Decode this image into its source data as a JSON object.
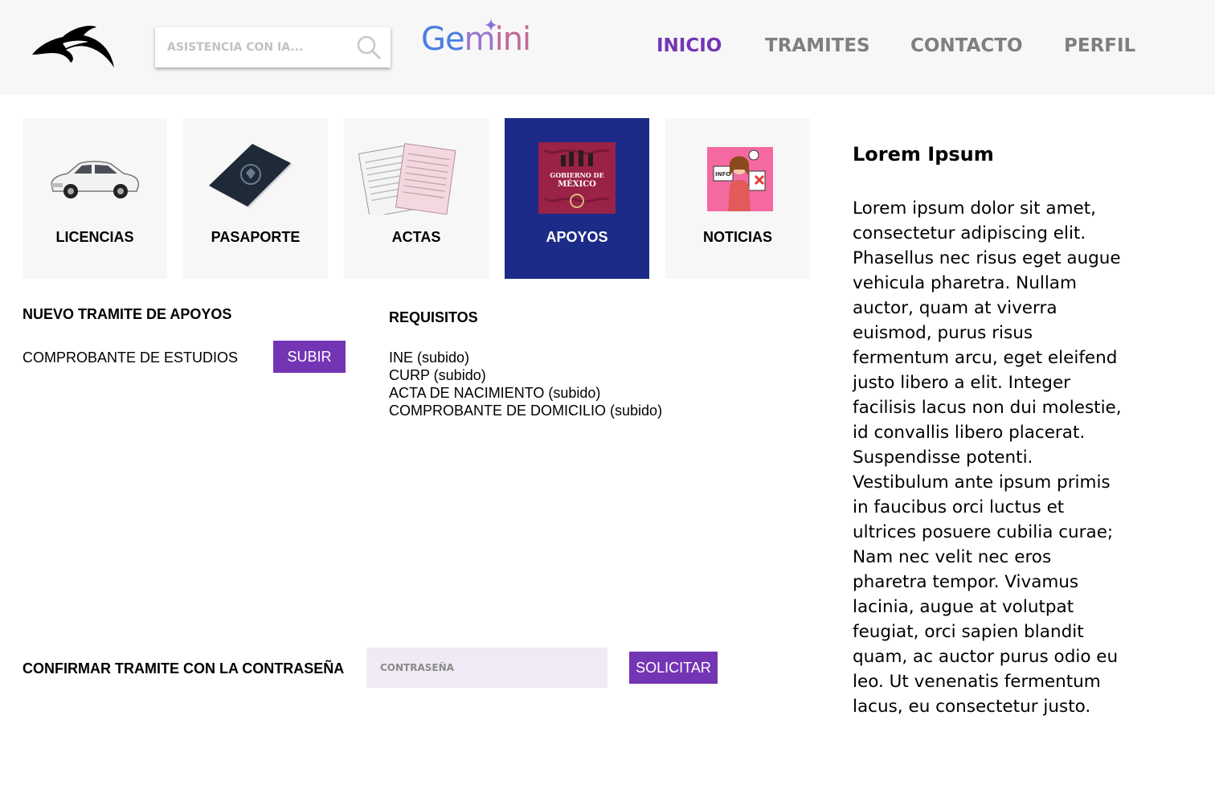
{
  "header": {
    "search_placeholder": "ASISTENCIA CON IA...",
    "gemini": {
      "g": "Ge",
      "m": "m",
      "ini": "ini"
    },
    "nav": [
      {
        "label": "INICIO",
        "active": true
      },
      {
        "label": "TRAMITES",
        "active": false
      },
      {
        "label": "CONTACTO",
        "active": false
      },
      {
        "label": "PERFIL",
        "active": false
      }
    ]
  },
  "cards": [
    {
      "label": "LICENCIAS",
      "icon": "car-icon"
    },
    {
      "label": "PASAPORTE",
      "icon": "passport-icon"
    },
    {
      "label": "ACTAS",
      "icon": "certificate-documents-icon"
    },
    {
      "label": "APOYOS",
      "icon": "gobierno-de-mexico-seal-icon",
      "active": true,
      "seal_text": [
        "GOBIERNO DE",
        "MÉXICO"
      ]
    },
    {
      "label": "NOTICIAS",
      "icon": "news-reporter-icon",
      "badge_text": "INFO"
    }
  ],
  "form": {
    "title": "NUEVO TRAMITE DE APOYOS",
    "upload_label": "COMPROBANTE DE ESTUDIOS",
    "upload_button": "SUBIR",
    "requirements_title": "REQUISITOS",
    "requirements": [
      "INE (subido)",
      "CURP (subido)",
      "ACTA DE NACIMIENTO (subido)",
      "COMPROBANTE DE DOMICILIO (subido)"
    ],
    "confirm_label": "CONFIRMAR TRAMITE CON LA CONTRASEÑA",
    "password_placeholder": "CONTRASEÑA",
    "submit_button": "SOLICITAR"
  },
  "sidebar": {
    "title": "Lorem Ipsum",
    "body": "Lorem ipsum dolor sit amet, consectetur adipiscing elit. Phasellus nec risus eget augue vehicula pharetra. Nullam auctor, quam at viverra euismod, purus risus fermentum arcu, eget eleifend justo libero a elit. Integer facilisis lacus non dui molestie, id convallis libero placerat. Suspendisse potenti. Vestibulum ante ipsum primis in faucibus orci luctus et ultrices posuere cubilia curae; Nam nec velit nec eros pharetra tempor. Vivamus lacinia, augue at volutpat feugiat, orci sapien blandit quam, ac auctor purus odio eu leo. Ut venenatis fermentum lacus, eu consectetur justo."
  },
  "colors": {
    "accent": "#7435b5",
    "active_card": "#1c2b87",
    "header_bg": "#f7f7f7",
    "password_bg": "#efeaf5"
  }
}
